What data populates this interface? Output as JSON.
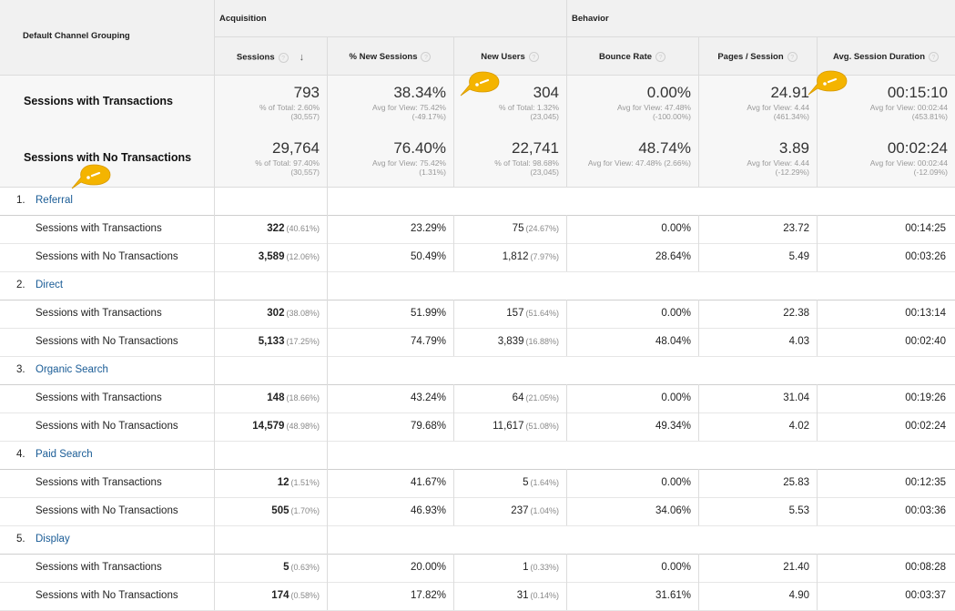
{
  "header": {
    "dimension_label": "Default Channel Grouping",
    "group_acquisition": "Acquisition",
    "group_behavior": "Behavior",
    "columns": [
      {
        "label": "Sessions",
        "sorted": true
      },
      {
        "label": "% New Sessions"
      },
      {
        "label": "New Users"
      },
      {
        "label": "Bounce Rate"
      },
      {
        "label": "Pages / Session"
      },
      {
        "label": "Avg. Session Duration"
      }
    ],
    "help_glyph": "?",
    "sort_glyph": "↓"
  },
  "totals": [
    {
      "label": "Sessions with Transactions",
      "cells": [
        {
          "value": "793",
          "sub1": "% of Total: 2.60%",
          "sub2": "(30,557)"
        },
        {
          "value": "38.34%",
          "sub1": "Avg for View: 75.42%",
          "sub2": "(-49.17%)"
        },
        {
          "value": "304",
          "sub1": "% of Total: 1.32%",
          "sub2": "(23,045)"
        },
        {
          "value": "0.00%",
          "sub1": "Avg for View: 47.48%",
          "sub2": "(-100.00%)"
        },
        {
          "value": "24.91",
          "sub1": "Avg for View: 4.44",
          "sub2": "(461.34%)"
        },
        {
          "value": "00:15:10",
          "sub1": "Avg for View: 00:02:44",
          "sub2": "(453.81%)"
        }
      ]
    },
    {
      "label": "Sessions with No Transactions",
      "cells": [
        {
          "value": "29,764",
          "sub1": "% of Total: 97.40%",
          "sub2": "(30,557)"
        },
        {
          "value": "76.40%",
          "sub1": "Avg for View: 75.42%",
          "sub2": "(1.31%)"
        },
        {
          "value": "22,741",
          "sub1": "% of Total: 98.68%",
          "sub2": "(23,045)"
        },
        {
          "value": "48.74%",
          "sub1": "Avg for View: 47.48% (2.66%)",
          "sub2": ""
        },
        {
          "value": "3.89",
          "sub1": "Avg for View: 4.44",
          "sub2": "(-12.29%)"
        },
        {
          "value": "00:02:24",
          "sub1": "Avg for View: 00:02:44",
          "sub2": "(-12.09%)"
        }
      ]
    }
  ],
  "channels": [
    {
      "index": "1.",
      "name": "Referral",
      "rows": [
        {
          "label": "Sessions with Transactions",
          "sessions": "322",
          "sessions_pct": "(40.61%)",
          "new_sessions": "23.29%",
          "new_users": "75",
          "new_users_pct": "(24.67%)",
          "bounce": "0.00%",
          "pages": "23.72",
          "duration": "00:14:25"
        },
        {
          "label": "Sessions with No Transactions",
          "sessions": "3,589",
          "sessions_pct": "(12.06%)",
          "new_sessions": "50.49%",
          "new_users": "1,812",
          "new_users_pct": "(7.97%)",
          "bounce": "28.64%",
          "pages": "5.49",
          "duration": "00:03:26"
        }
      ]
    },
    {
      "index": "2.",
      "name": "Direct",
      "rows": [
        {
          "label": "Sessions with Transactions",
          "sessions": "302",
          "sessions_pct": "(38.08%)",
          "new_sessions": "51.99%",
          "new_users": "157",
          "new_users_pct": "(51.64%)",
          "bounce": "0.00%",
          "pages": "22.38",
          "duration": "00:13:14"
        },
        {
          "label": "Sessions with No Transactions",
          "sessions": "5,133",
          "sessions_pct": "(17.25%)",
          "new_sessions": "74.79%",
          "new_users": "3,839",
          "new_users_pct": "(16.88%)",
          "bounce": "48.04%",
          "pages": "4.03",
          "duration": "00:02:40"
        }
      ]
    },
    {
      "index": "3.",
      "name": "Organic Search",
      "rows": [
        {
          "label": "Sessions with Transactions",
          "sessions": "148",
          "sessions_pct": "(18.66%)",
          "new_sessions": "43.24%",
          "new_users": "64",
          "new_users_pct": "(21.05%)",
          "bounce": "0.00%",
          "pages": "31.04",
          "duration": "00:19:26"
        },
        {
          "label": "Sessions with No Transactions",
          "sessions": "14,579",
          "sessions_pct": "(48.98%)",
          "new_sessions": "79.68%",
          "new_users": "11,617",
          "new_users_pct": "(51.08%)",
          "bounce": "49.34%",
          "pages": "4.02",
          "duration": "00:02:24"
        }
      ]
    },
    {
      "index": "4.",
      "name": "Paid Search",
      "rows": [
        {
          "label": "Sessions with Transactions",
          "sessions": "12",
          "sessions_pct": "(1.51%)",
          "new_sessions": "41.67%",
          "new_users": "5",
          "new_users_pct": "(1.64%)",
          "bounce": "0.00%",
          "pages": "25.83",
          "duration": "00:12:35"
        },
        {
          "label": "Sessions with No Transactions",
          "sessions": "505",
          "sessions_pct": "(1.70%)",
          "new_sessions": "46.93%",
          "new_users": "237",
          "new_users_pct": "(1.04%)",
          "bounce": "34.06%",
          "pages": "5.53",
          "duration": "00:03:36"
        }
      ]
    },
    {
      "index": "5.",
      "name": "Display",
      "rows": [
        {
          "label": "Sessions with Transactions",
          "sessions": "5",
          "sessions_pct": "(0.63%)",
          "new_sessions": "20.00%",
          "new_users": "1",
          "new_users_pct": "(0.33%)",
          "bounce": "0.00%",
          "pages": "21.40",
          "duration": "00:08:28"
        },
        {
          "label": "Sessions with No Transactions",
          "sessions": "174",
          "sessions_pct": "(0.58%)",
          "new_sessions": "17.82%",
          "new_users": "31",
          "new_users_pct": "(0.14%)",
          "bounce": "31.61%",
          "pages": "4.90",
          "duration": "00:03:37"
        }
      ]
    }
  ],
  "annotation_pins": [
    "pin-icon",
    "pin-icon",
    "pin-icon"
  ],
  "colors": {
    "pin": "#f4b400",
    "link": "#1a5c96",
    "header_bg": "#f1f1f1"
  }
}
